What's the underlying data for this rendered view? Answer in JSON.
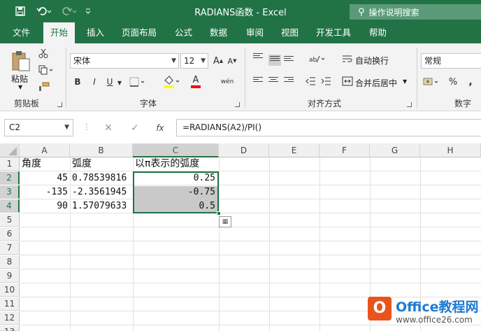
{
  "window": {
    "title": "RADIANS函数  -  Excel"
  },
  "tell_me": {
    "placeholder": "操作说明搜索"
  },
  "ribbon_tabs": [
    "文件",
    "开始",
    "插入",
    "页面布局",
    "公式",
    "数据",
    "审阅",
    "视图",
    "开发工具",
    "帮助"
  ],
  "active_tab": "开始",
  "clipboard": {
    "paste_label": "粘贴",
    "group_label": "剪贴板"
  },
  "font": {
    "name": "宋体",
    "size": "12",
    "group_label": "字体",
    "bold": "B",
    "italic": "I",
    "underline": "U",
    "grow": "A",
    "shrink": "A",
    "font_color": "A",
    "phonetic": "wén"
  },
  "alignment": {
    "wrap_text": "自动换行",
    "merge_center": "合并后居中",
    "group_label": "对齐方式"
  },
  "number": {
    "format": "常规",
    "percent": "%",
    "group_label": "数字"
  },
  "formula_bar": {
    "name_box": "C2",
    "fx": "fx",
    "formula": "=RADIANS(A2)/PI()"
  },
  "columns": [
    "A",
    "B",
    "C",
    "D",
    "E",
    "F",
    "G",
    "H"
  ],
  "rows": [
    "1",
    "2",
    "3",
    "4",
    "5",
    "6",
    "7",
    "8",
    "9",
    "10",
    "11",
    "12",
    "13"
  ],
  "cells": {
    "A1": "角度",
    "B1": "弧度",
    "C1": "以π表示的弧度",
    "A2": "45",
    "B2": "0.78539816",
    "C2": "0.25",
    "A3": "-135",
    "B3": "-2.3561945",
    "C3": "-0.75",
    "A4": "90",
    "B4": "1.57079633",
    "C4": "0.5"
  },
  "watermark": {
    "logo": "O",
    "title": "Office教程网",
    "url": "www.office26.com"
  },
  "colors": {
    "excel_green": "#217346",
    "selection_gray": "#c9c9c9"
  }
}
